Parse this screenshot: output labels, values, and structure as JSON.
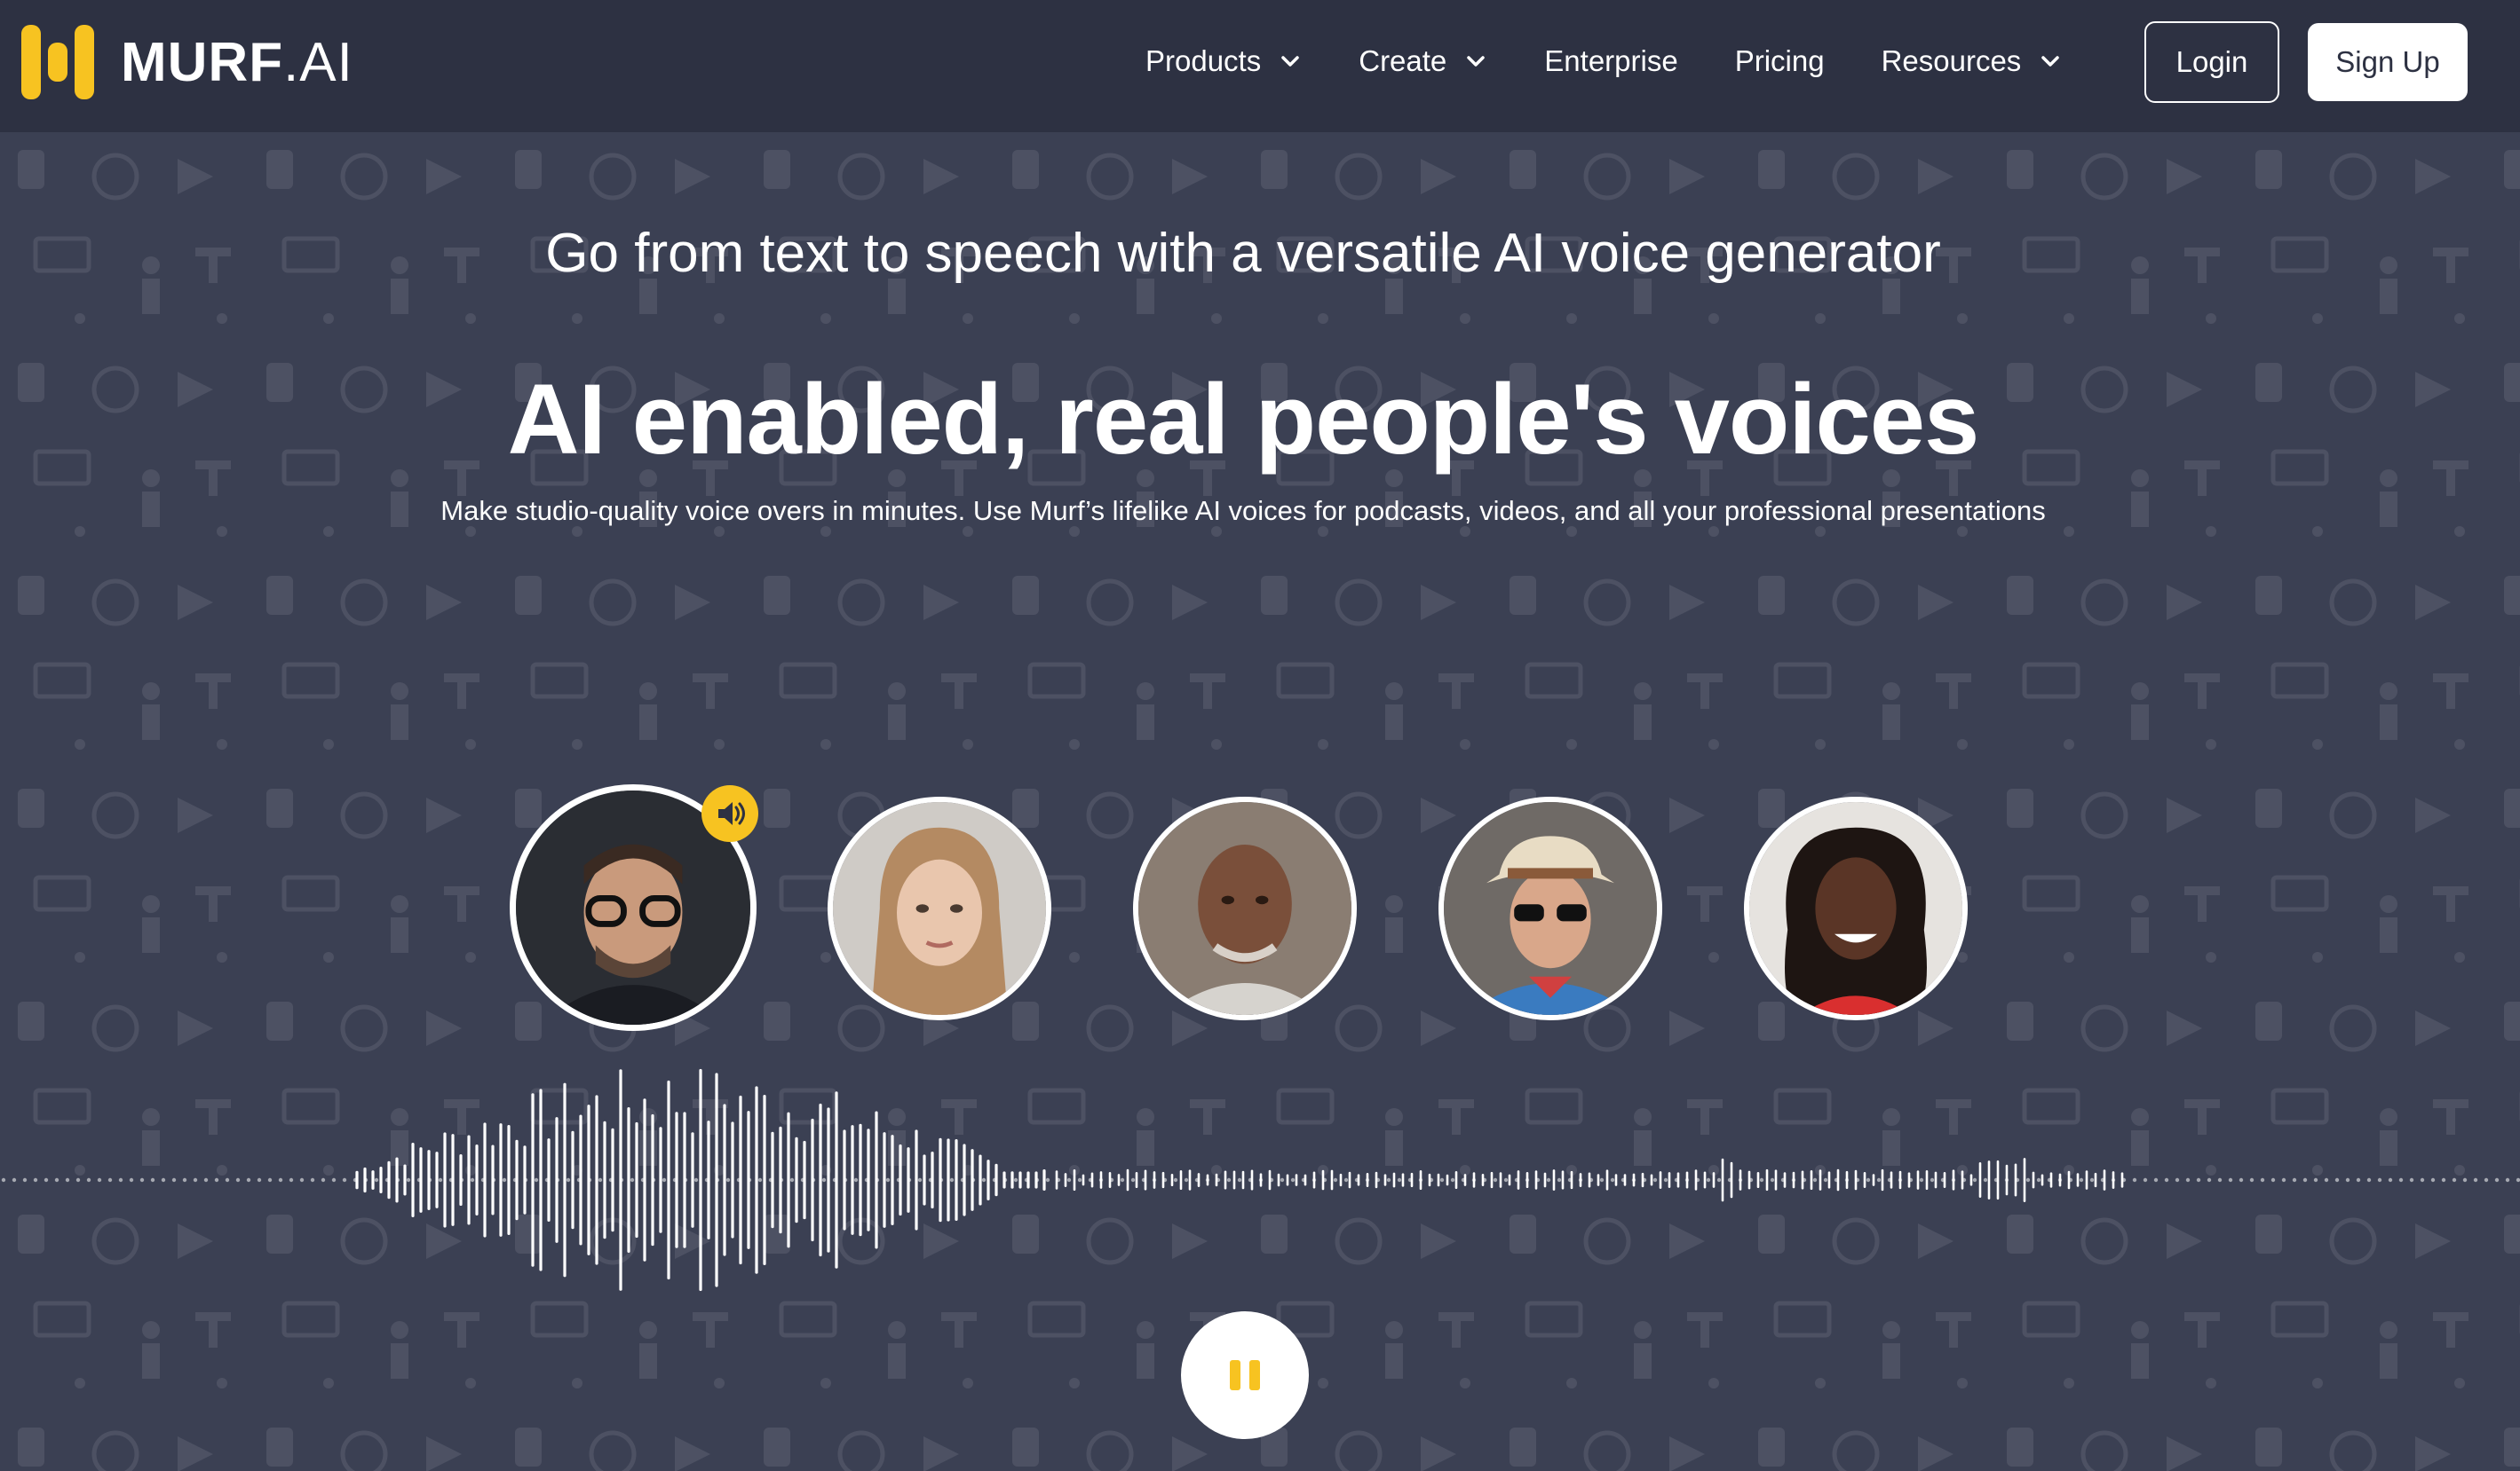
{
  "header": {
    "logo": {
      "brand": "MURF",
      "suffix": ".AI",
      "icon": "murf-logo-icon",
      "color": "#f7c321"
    },
    "nav": [
      {
        "label": "Products",
        "has_dropdown": true
      },
      {
        "label": "Create",
        "has_dropdown": true
      },
      {
        "label": "Enterprise",
        "has_dropdown": false
      },
      {
        "label": "Pricing",
        "has_dropdown": false
      },
      {
        "label": "Resources",
        "has_dropdown": true
      }
    ],
    "login_label": "Login",
    "signup_label": "Sign Up"
  },
  "hero": {
    "subtitle": "Go from text to speech with a versatile AI voice generator",
    "title": "AI enabled, real people's voices",
    "description": "Make studio-quality voice overs in minutes. Use Murf’s lifelike AI voices for podcasts, videos, and all your professional presentations"
  },
  "voices": [
    {
      "name": "voice-avatar-1",
      "active": true
    },
    {
      "name": "voice-avatar-2",
      "active": false
    },
    {
      "name": "voice-avatar-3",
      "active": false
    },
    {
      "name": "voice-avatar-4",
      "active": false
    },
    {
      "name": "voice-avatar-5",
      "active": false
    }
  ],
  "player": {
    "state": "playing",
    "icon": "pause-icon"
  },
  "colors": {
    "accent": "#f7c321",
    "header_bg": "#2d3142",
    "page_bg": "#3b4053"
  }
}
